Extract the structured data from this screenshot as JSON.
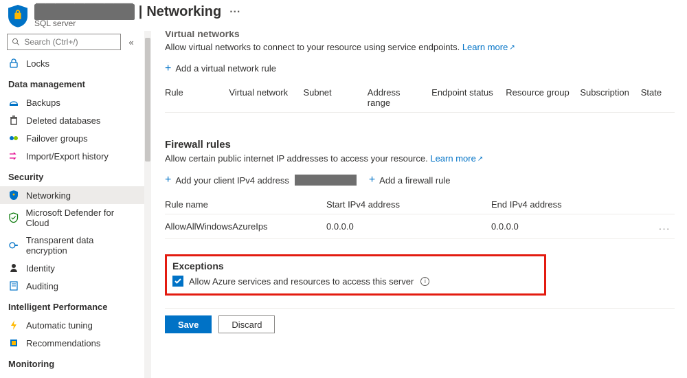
{
  "header": {
    "server_redacted": "██████████",
    "separator": " | ",
    "page": "Networking",
    "subtitle": "SQL server",
    "more": "···"
  },
  "search": {
    "placeholder": "Search (Ctrl+/)"
  },
  "collapse_glyph": "«",
  "sidebar": {
    "top_items": [
      {
        "label": "Locks"
      }
    ],
    "sections": [
      {
        "title": "Data management",
        "items": [
          {
            "label": "Backups"
          },
          {
            "label": "Deleted databases"
          },
          {
            "label": "Failover groups"
          },
          {
            "label": "Import/Export history"
          }
        ]
      },
      {
        "title": "Security",
        "items": [
          {
            "label": "Networking",
            "active": true
          },
          {
            "label": "Microsoft Defender for Cloud"
          },
          {
            "label": "Transparent data encryption"
          },
          {
            "label": "Identity"
          },
          {
            "label": "Auditing"
          }
        ]
      },
      {
        "title": "Intelligent Performance",
        "items": [
          {
            "label": "Automatic tuning"
          },
          {
            "label": "Recommendations"
          }
        ]
      },
      {
        "title": "Monitoring",
        "items": []
      }
    ]
  },
  "vnet": {
    "title": "Virtual networks",
    "desc": "Allow virtual networks to connect to your resource using service endpoints. ",
    "learn": "Learn more",
    "add": "Add a virtual network rule",
    "columns": [
      "Rule",
      "Virtual network",
      "Subnet",
      "Address range",
      "Endpoint status",
      "Resource group",
      "Subscription",
      "State"
    ]
  },
  "firewall": {
    "title": "Firewall rules",
    "desc": "Allow certain public internet IP addresses to access your resource. ",
    "learn": "Learn more",
    "add_client": "Add your client IPv4 address",
    "add_rule": "Add a firewall rule",
    "columns": [
      "Rule name",
      "Start IPv4 address",
      "End IPv4 address"
    ],
    "rows": [
      {
        "name": "AllowAllWindowsAzureIps",
        "start": "0.0.0.0",
        "end": "0.0.0.0"
      }
    ],
    "row_more": "..."
  },
  "exceptions": {
    "title": "Exceptions",
    "checkbox_label": "Allow Azure services and resources to access this server",
    "checked": true
  },
  "footer": {
    "save": "Save",
    "discard": "Discard"
  }
}
